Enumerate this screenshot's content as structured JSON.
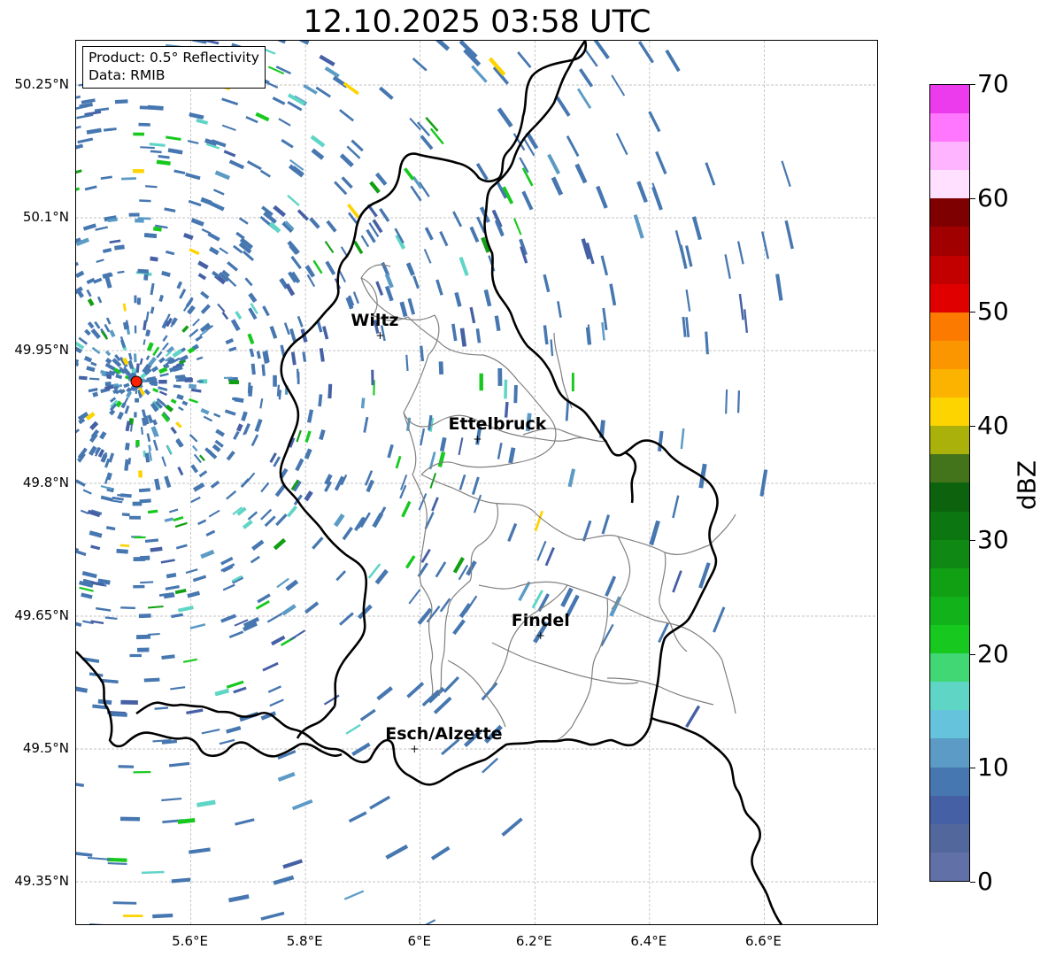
{
  "title": "12.10.2025 03:58 UTC",
  "info": {
    "product": "Product: 0.5° Reflectivity",
    "data": "Data: RMIB"
  },
  "axes": {
    "lat_ticks": [
      "50.25°N",
      "50.1°N",
      "49.95°N",
      "49.8°N",
      "49.65°N",
      "49.5°N",
      "49.35°N"
    ],
    "lon_ticks": [
      "5.6°E",
      "5.8°E",
      "6°E",
      "6.2°E",
      "6.4°E",
      "6.6°E"
    ],
    "lat_values": [
      50.25,
      50.1,
      49.95,
      49.8,
      49.65,
      49.5,
      49.35
    ],
    "lon_values": [
      5.6,
      5.8,
      6.0,
      6.2,
      6.4,
      6.6
    ],
    "lon_range": [
      5.4,
      6.8
    ],
    "lat_range": [
      49.3,
      50.3
    ],
    "grid": true
  },
  "colorbar": {
    "label": "dBZ",
    "ticks": [
      "0",
      "10",
      "20",
      "30",
      "40",
      "50",
      "60",
      "70"
    ],
    "tick_values": [
      0,
      10,
      20,
      30,
      40,
      50,
      60,
      70
    ],
    "range": [
      0,
      70
    ],
    "colors": [
      "#6170a6",
      "#52689c",
      "#4660a5",
      "#4677b0",
      "#5b9bc5",
      "#66c3dc",
      "#5fd5c6",
      "#40d774",
      "#17c91f",
      "#12b31a",
      "#119f14",
      "#0f8913",
      "#0c7611",
      "#0c620d",
      "#43731a",
      "#aab10b",
      "#fdd300",
      "#fbb300",
      "#fc9600",
      "#fd7a00",
      "#e10000",
      "#c20000",
      "#a10000",
      "#7f0000",
      "#ffe1ff",
      "#ffb4ff",
      "#ff77ff",
      "#ec3bec"
    ]
  },
  "cities": [
    {
      "name": "Wiltz",
      "lon": 5.93,
      "lat": 49.967
    },
    {
      "name": "Ettelbruck",
      "lon": 6.1,
      "lat": 49.85
    },
    {
      "name": "Findel",
      "lon": 6.21,
      "lat": 49.628
    },
    {
      "name": "Esch/Alzette",
      "lon": 5.99,
      "lat": 49.5
    }
  ],
  "radar_site": {
    "lon": 5.505,
    "lat": 49.915
  },
  "colors": {
    "border": "#000000",
    "canton_lines": "#808080",
    "radar_marker": "#ff2000",
    "grid": "#b0b0b0"
  }
}
